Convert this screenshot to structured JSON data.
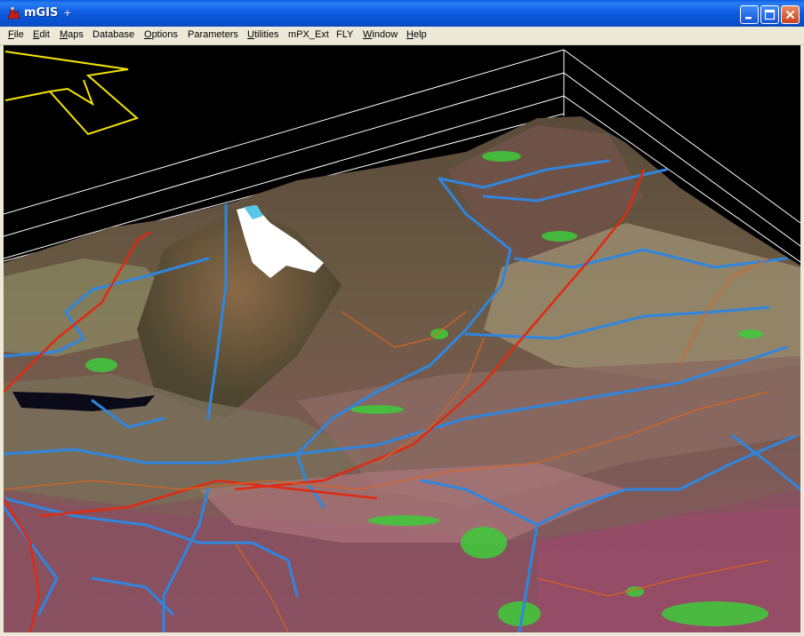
{
  "window": {
    "title": "mGIS",
    "title_marker": "+",
    "accent": "#0a5fe0"
  },
  "controls": {
    "minimize_icon": "minimize-icon",
    "maximize_icon": "maximize-icon",
    "close_icon": "close-icon"
  },
  "menu": [
    {
      "first": "F",
      "rest": "ile"
    },
    {
      "first": "E",
      "rest": "dit"
    },
    {
      "first": "M",
      "rest": "aps"
    },
    {
      "first": "",
      "rest": "Database"
    },
    {
      "first": "O",
      "rest": "ptions"
    },
    {
      "first": "",
      "rest": "Parameters"
    },
    {
      "first": "U",
      "rest": "tilities"
    },
    {
      "first": "",
      "rest": "mPX_Ext"
    },
    {
      "first": "",
      "rest": "FLY"
    },
    {
      "first": "W",
      "rest": "indow"
    },
    {
      "first": "H",
      "rest": "elp"
    }
  ],
  "view": {
    "background": "#000000",
    "arrow_color": "#f2e400",
    "river_color": "#2e86e0",
    "road_color": "#e02a10",
    "box_color": "#ffffff"
  }
}
